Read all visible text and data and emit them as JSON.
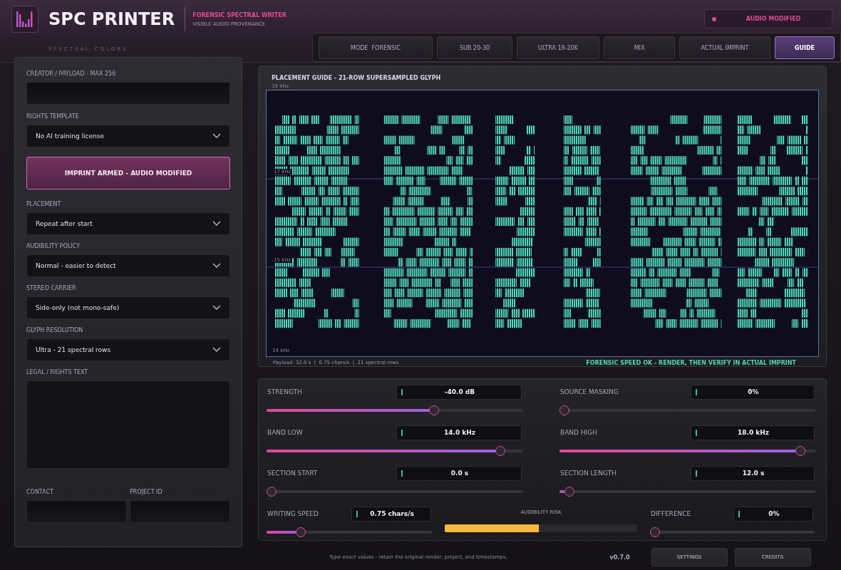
{
  "header": {
    "title": "SPC PRINTER",
    "subtitle": "SPECTRAL COLORS",
    "tagline": "FORENSIC SPECTRAL WRITER",
    "caption": "VISIBLE AUDIO PROVENANCE",
    "status": {
      "label": "AUDIO MODIFIED",
      "color": "#e0489a"
    }
  },
  "tabs": [
    {
      "label": "MODE  FORENSIC",
      "selected": false
    },
    {
      "label": "SUB 20-30",
      "selected": false
    },
    {
      "label": "ULTRA 19-20K",
      "selected": false
    },
    {
      "label": "MIX",
      "selected": false
    },
    {
      "label": "ACTUAL IMPRINT",
      "selected": false
    },
    {
      "label": "GUIDE",
      "selected": true
    }
  ],
  "left": {
    "payload": {
      "label": "CREATOR / PAYLOAD - MAX 256"
    },
    "rights": {
      "label": "RIGHTS TEMPLATE",
      "value": "No AI training license"
    },
    "action": {
      "label": "IMPRINT ARMED - AUDIO MODIFIED"
    },
    "selects": [
      {
        "label": "PLACEMENT",
        "value": "Repeat after start"
      },
      {
        "label": "AUDIBILITY POLICY",
        "value": "Normal - easier to detect"
      },
      {
        "label": "STEREO CARRIER",
        "value": "Side-only (not mono-safe)"
      },
      {
        "label": "GLYPH RESOLUTION",
        "value": "Ultra - 21 spectral rows"
      }
    ],
    "legal": {
      "label": "LEGAL / RIGHTS TEXT"
    },
    "contact": {
      "label": "CONTACT"
    },
    "project": {
      "label": "PROJECT ID"
    }
  },
  "guide": {
    "title": "PLACEMENT GUIDE - 21-ROW SUPERSAMPLED GLYPH",
    "top_label": "19 kHz",
    "grid_labels": [
      "17 kHz",
      "15 kHz"
    ],
    "bottom_label": "14 kHz",
    "stats": "Payload  32.0 s  |  0.75 chars/s  |  21 spectral rows",
    "verdict": "FORENSIC SPEED OK - RENDER, THEN VERIFY IN ACTUAL IMPRINT"
  },
  "controls": [
    {
      "label": "STRENGTH",
      "reading": "-40.0 dB",
      "level": 0.66
    },
    {
      "label": "SOURCE MASKING",
      "reading": "0%",
      "level": 0
    },
    {
      "label": "BAND LOW",
      "reading": "14.0 kHz",
      "level": 0.93
    },
    {
      "label": "BAND HIGH",
      "reading": "18.0 kHz",
      "level": 0.96
    },
    {
      "label": "SECTION START",
      "reading": "0.0 s",
      "level": 0
    },
    {
      "label": "SECTION LENGTH",
      "reading": "12.0 s",
      "level": 0.02
    }
  ],
  "bottom": {
    "speed": {
      "label": "WRITING SPEED",
      "reading": "0.75 chars/s",
      "level": 0.19
    },
    "risk": {
      "label": "AUDIBILITY RISK",
      "level": 0.49
    },
    "difference": {
      "label": "DIFFERENCE",
      "reading": "0%",
      "level": 0
    }
  },
  "footer": {
    "note": "Type exact values - retain the original render, project, and timestamps.",
    "version": "v0.7.0",
    "buttons": [
      "SETTINGS",
      "CREDITS"
    ]
  }
}
